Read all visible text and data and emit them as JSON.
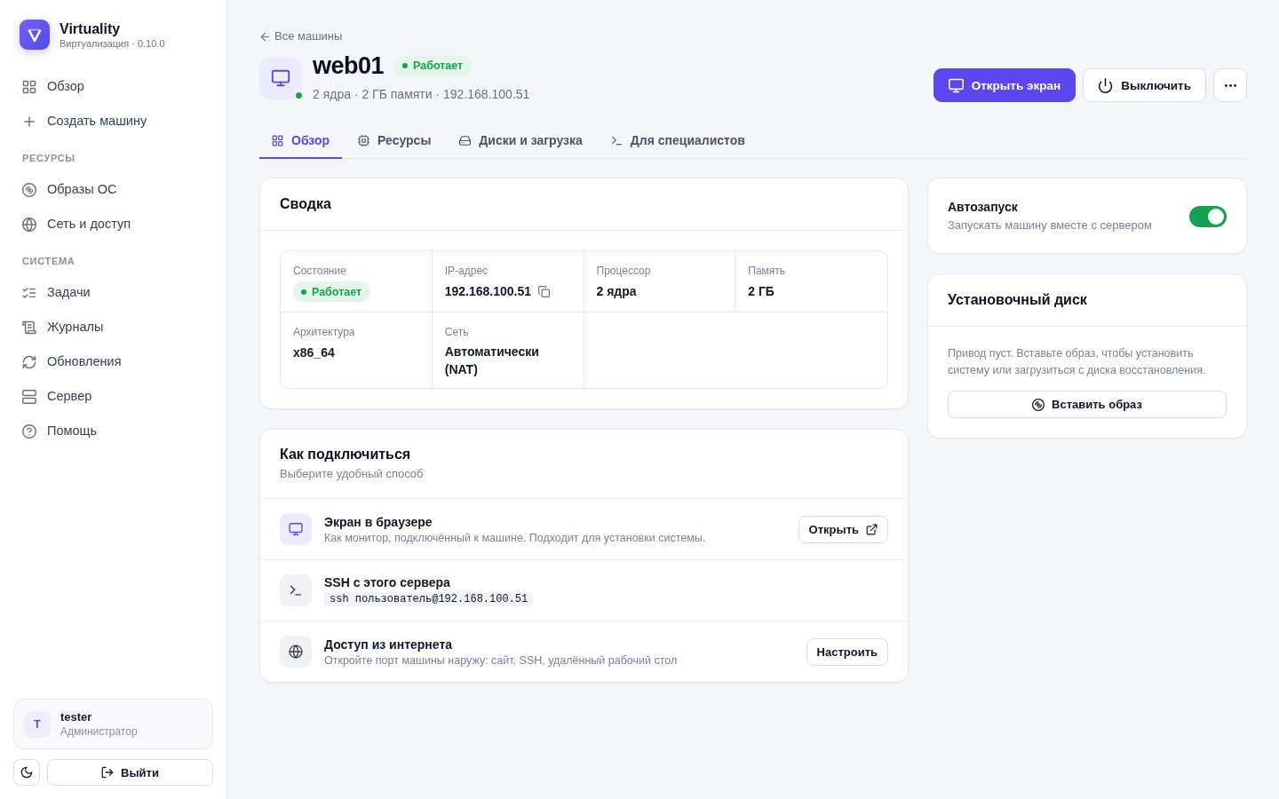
{
  "sidebar": {
    "brand": {
      "name": "Virtuality",
      "subtitle": "Виртуализация · 0.10.0"
    },
    "items": [
      {
        "label": "Обзор",
        "selected": false
      },
      {
        "label": "Создать машину",
        "selected": false
      }
    ],
    "sections": [
      {
        "title": "РЕСУРСЫ",
        "items": [
          {
            "label": "Образы ОС",
            "selected": false
          },
          {
            "label": "Сеть и доступ",
            "selected": false
          }
        ]
      },
      {
        "title": "СИСТЕМА",
        "items": [
          {
            "label": "Задачи",
            "selected": false
          },
          {
            "label": "Журналы",
            "selected": false
          },
          {
            "label": "Обновления",
            "selected": false
          },
          {
            "label": "Сервер",
            "selected": false
          },
          {
            "label": "Помощь",
            "selected": false
          }
        ]
      }
    ],
    "user": {
      "initial": "T",
      "name": "tester",
      "role": "Администратор"
    },
    "logout": "Выйти"
  },
  "header": {
    "back_link": "Все машины",
    "title": "web01",
    "status": {
      "label": "Работает",
      "running": true
    },
    "summary": "2 ядра · 2 ГБ памяти · 192.168.100.51",
    "actions": [
      {
        "label": "Открыть экран",
        "kind": "primary"
      },
      {
        "label": "Выключить",
        "kind": "secondary"
      }
    ]
  },
  "tabs": [
    {
      "label": "Обзор",
      "selected": true
    },
    {
      "label": "Ресурсы",
      "selected": false
    },
    {
      "label": "Диски и загрузка",
      "selected": false
    },
    {
      "label": "Для специалистов",
      "selected": false
    }
  ],
  "summary_card": {
    "title": "Сводка",
    "fields": [
      {
        "kind": "status",
        "label": "Состояние",
        "value": "Работает",
        "running": true
      },
      {
        "kind": "copy",
        "label": "IP-адрес",
        "value": "192.168.100.51"
      },
      {
        "kind": "text",
        "label": "Процессор",
        "value": "2 ядра"
      },
      {
        "kind": "text",
        "label": "Память",
        "value": "2 ГБ"
      },
      {
        "kind": "text",
        "label": "Архитектура",
        "value": "x86_64"
      },
      {
        "kind": "text",
        "label": "Сеть",
        "value": "Автоматически (NAT)"
      }
    ]
  },
  "connect_card": {
    "title": "Как подключиться",
    "subtitle": "Выберите удобный способ",
    "methods": [
      {
        "kind": "text",
        "highlighted": true,
        "title": "Экран в браузере",
        "description": "Как монитор, подключённый к машине. Подходит для установки системы.",
        "action": {
          "label": "Открыть",
          "external": true
        }
      },
      {
        "kind": "command",
        "highlighted": false,
        "title": "SSH с этого сервера",
        "command": "ssh пользователь@192.168.100.51"
      },
      {
        "kind": "text",
        "highlighted": false,
        "title": "Доступ из интернета",
        "description": "Откройте порт машины наружу: сайт, SSH, удалённый рабочий стол",
        "action": {
          "label": "Настроить",
          "external": false
        }
      }
    ]
  },
  "autostart": {
    "title": "Автозапуск",
    "description": "Запускать машину вместе с сервером",
    "on": true
  },
  "install_disc": {
    "title": "Установочный диск",
    "text": "Привод пуст. Вставьте образ, чтобы установить систему или загрузиться с диска восстановления.",
    "action": "Вставить образ"
  }
}
